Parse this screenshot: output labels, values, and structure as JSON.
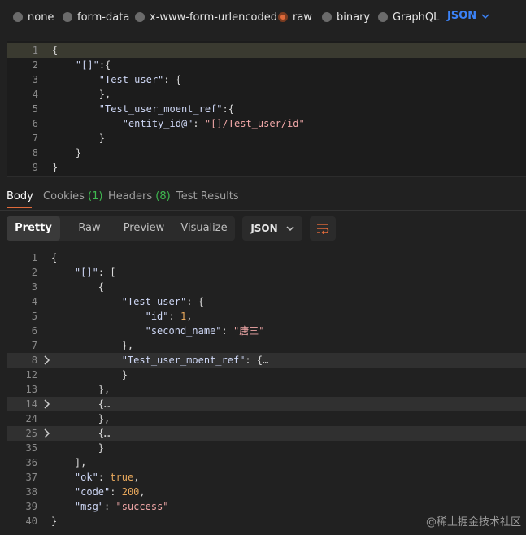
{
  "body_types": [
    {
      "label": "none",
      "selected": false
    },
    {
      "label": "form-data",
      "selected": false
    },
    {
      "label": "x-www-form-urlencoded",
      "selected": false
    },
    {
      "label": "raw",
      "selected": true
    },
    {
      "label": "binary",
      "selected": false
    },
    {
      "label": "GraphQL",
      "selected": false
    }
  ],
  "raw_format": "JSON",
  "request_lines": [
    {
      "n": "1",
      "code": "{"
    },
    {
      "n": "2",
      "code": "    \"[]\":{"
    },
    {
      "n": "3",
      "code": "        \"Test_user\": {"
    },
    {
      "n": "4",
      "code": "        },"
    },
    {
      "n": "5",
      "code": "        \"Test_user_moent_ref\":{"
    },
    {
      "n": "6",
      "code": "            \"entity_id@\": \"[]/Test_user/id\""
    },
    {
      "n": "7",
      "code": "        }"
    },
    {
      "n": "8",
      "code": "    }"
    },
    {
      "n": "9",
      "code": "}"
    }
  ],
  "response_tabs": {
    "body": "Body",
    "cookies": "Cookies",
    "cookies_count": "(1)",
    "headers": "Headers",
    "headers_count": "(8)",
    "test_results": "Test Results"
  },
  "view_modes": [
    "Pretty",
    "Raw",
    "Preview",
    "Visualize"
  ],
  "active_view": "Pretty",
  "response_format": "JSON",
  "response_lines": [
    {
      "n": "1",
      "code": "{"
    },
    {
      "n": "2",
      "code": "    \"[]\": ["
    },
    {
      "n": "3",
      "code": "        {"
    },
    {
      "n": "4",
      "code": "            \"Test_user\": {"
    },
    {
      "n": "5",
      "code": "                \"id\": 1,"
    },
    {
      "n": "6",
      "code": "                \"second_name\": \"唐三\""
    },
    {
      "n": "7",
      "code": "            },"
    },
    {
      "n": "8",
      "code": "            \"Test_user_moent_ref\": {…",
      "folded": true
    },
    {
      "n": "12",
      "code": "            }"
    },
    {
      "n": "13",
      "code": "        },"
    },
    {
      "n": "14",
      "code": "        {…",
      "folded": true
    },
    {
      "n": "24",
      "code": "        },"
    },
    {
      "n": "25",
      "code": "        {…",
      "folded": true
    },
    {
      "n": "35",
      "code": "        }"
    },
    {
      "n": "36",
      "code": "    ],"
    },
    {
      "n": "37",
      "code": "    \"ok\": true,"
    },
    {
      "n": "38",
      "code": "    \"code\": 200,"
    },
    {
      "n": "39",
      "code": "    \"msg\": \"success\""
    },
    {
      "n": "40",
      "code": "}"
    }
  ],
  "watermark": "@稀土掘金技术社区",
  "colors": {
    "accent": "#e06a3a",
    "link": "#3b82f6",
    "count": "#3fb950"
  }
}
